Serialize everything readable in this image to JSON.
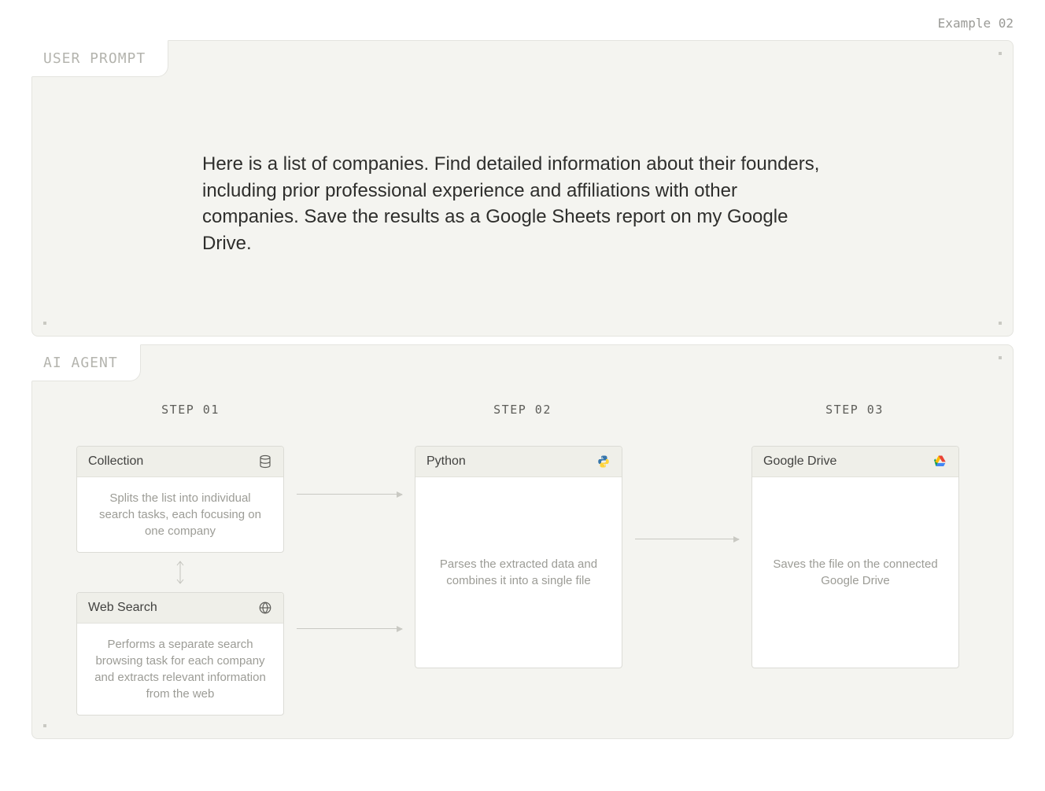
{
  "example_label": "Example 02",
  "user_panel": {
    "tab": "USER PROMPT",
    "prompt": "Here is a list of companies. Find detailed information about their founders, including prior professional experience and affiliations with other companies. Save the results as a Google Sheets report on my Google Drive."
  },
  "agent_panel": {
    "tab": "AI AGENT",
    "steps": [
      {
        "label": "STEP 01"
      },
      {
        "label": "STEP 02"
      },
      {
        "label": "STEP 03"
      }
    ],
    "cards": {
      "collection": {
        "title": "Collection",
        "desc": "Splits the list into individual search tasks, each focusing on one company"
      },
      "websearch": {
        "title": "Web Search",
        "desc": "Performs a separate search browsing task for each company and extracts relevant information from the web"
      },
      "python": {
        "title": "Python",
        "desc": "Parses the extracted data and combines it into a single file"
      },
      "gdrive": {
        "title": "Google Drive",
        "desc": "Saves the file on the connected Google Drive"
      }
    }
  }
}
